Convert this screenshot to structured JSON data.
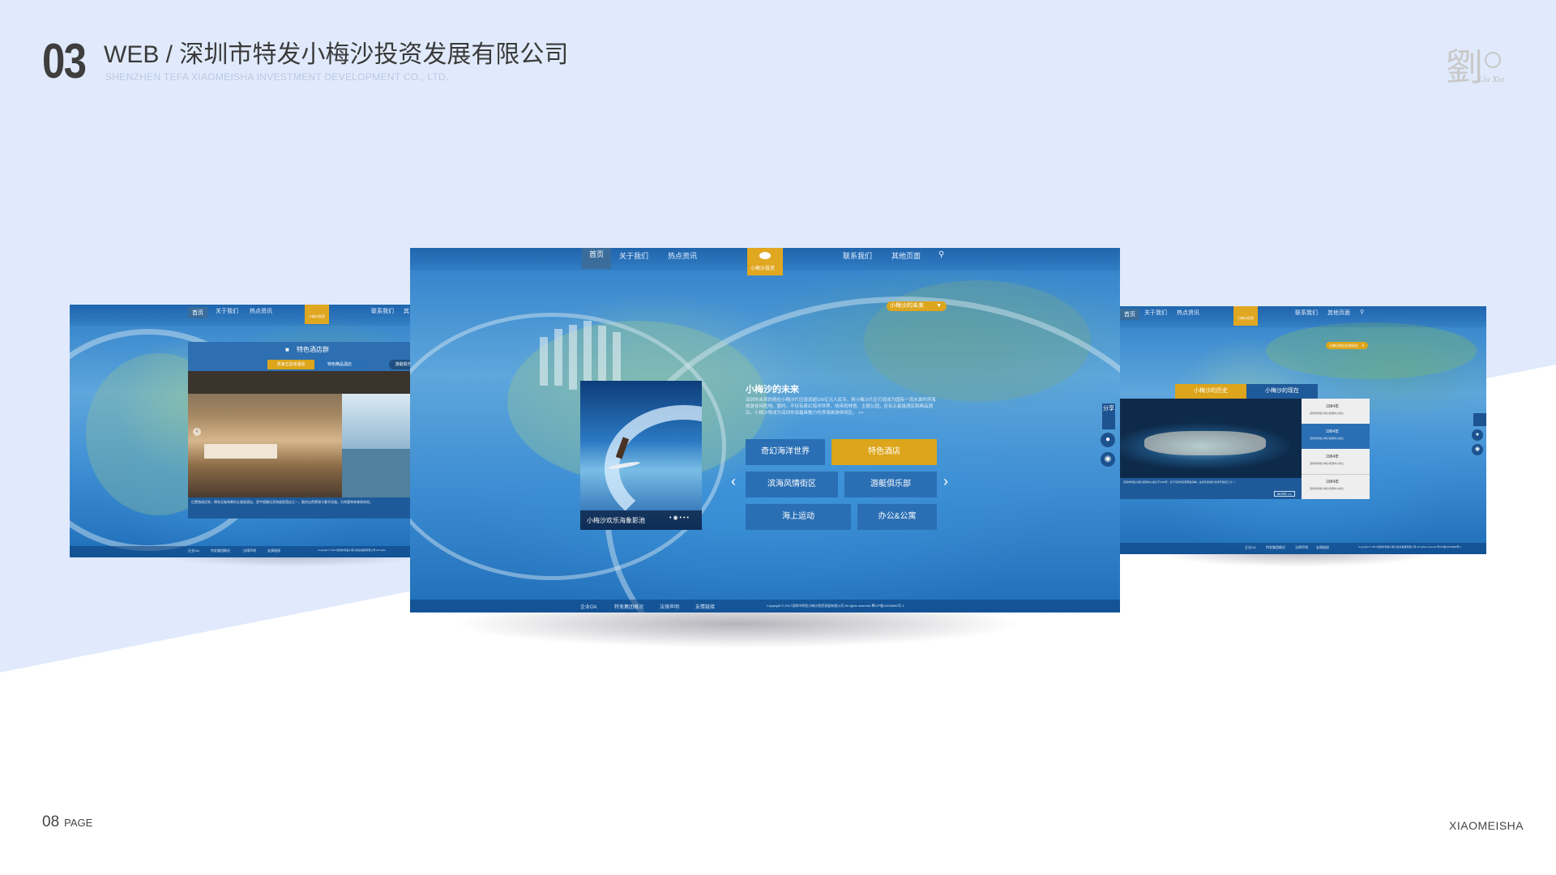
{
  "header": {
    "number": "03",
    "title": "WEB / 深圳市特发小梅沙投资发展有限公司",
    "subtitle": "SHENZHEN TEFA XIAOMEISHA INVESTMENT DEVELOPMENT CO., LTD."
  },
  "signature": {
    "glyph": "劉",
    "name": "Liu Xia"
  },
  "footer": {
    "page_number": "08",
    "page_label": "PAGE",
    "brand": "XIAOMEISHA"
  },
  "center_screen": {
    "nav": {
      "home": "首页",
      "about": "关于我们",
      "news": "热点资讯",
      "logo": "小梅沙投资",
      "contact": "联系我们",
      "other": "其他页面",
      "search_icon": "search-icon"
    },
    "dropdown": "小梅沙的未来",
    "feature_caption": "小梅沙欢乐海象影池",
    "section_title": "小梅沙的未来",
    "section_text": "深圳市未来的将在小梅沙片区投资超150亿元人民币，将小梅沙片区打造成为国际一流水准的滨海旅游休闲胜地。届时，不仅有奇幻海洋世界、热带雨林馆、主题公园，还有五星级酒店和精品酒店，小梅沙将成为深圳东部最具魅力的滨海旅游休闲区。 >>",
    "tiles": [
      "奇幻海洋世界",
      "特色酒店",
      "滨海风情街区",
      "游艇俱乐部",
      "海上运动",
      "办公&公寓"
    ],
    "share": "分享",
    "footer_links": [
      "企业OA",
      "特发集团概况",
      "法律声明",
      "友情链接"
    ],
    "copyright": "Copyright © 2017深圳市特发小梅沙投资发展有限公司 All rights reserved 粤ICP备12033882号-1"
  },
  "left_screen": {
    "nav": {
      "home": "首页",
      "about": "关于我们",
      "news": "热点资讯",
      "logo": "小梅沙投资",
      "contact": "联系我们",
      "other": "其"
    },
    "card_title": "特色酒店群",
    "tabs": [
      "滨海五星级酒店",
      "特色精品酒店",
      "游艇俱乐部"
    ],
    "card_text": "位置独具优势，拥有无敌海景的五星级酒店，是中国最佳滨海度假酒店之一，融合自然景观与奢华设施，为宾客带来尊贵体验。",
    "footer_links": [
      "企业OA",
      "特发集团概况",
      "法律声明",
      "友情链接"
    ],
    "copyright": "Copyright © 2017深圳市特发小梅沙投资发展有限公司 All rights"
  },
  "right_screen": {
    "nav": {
      "home": "首页",
      "about": "关于我们",
      "news": "热点资讯",
      "logo": "小梅沙投资",
      "contact": "联系我们",
      "other": "其他页面"
    },
    "dropdown": "小梅沙的历史和现在",
    "tabs": [
      "小梅沙的历史",
      "小梅沙的现在"
    ],
    "timeline": [
      {
        "year": "1984年",
        "text": "深圳市特发小梅沙旅游中心成立"
      },
      {
        "year": "1984年",
        "text": "深圳市特发小梅沙旅游中心成立"
      },
      {
        "year": "1984年",
        "text": "深圳市特发小梅沙旅游中心成立"
      },
      {
        "year": "1984年",
        "text": "深圳市特发小梅沙旅游中心成立"
      }
    ],
    "body_text": "深圳市特发小梅沙旅游中心成立于1984年，位于深圳市东部黄金海岸，是当年深圳的“改革开放窗口”之一。",
    "more": "MORE >>",
    "footer_links": [
      "企业OA",
      "特发集团概况",
      "法律声明",
      "友情链接"
    ],
    "copyright": "Copyright © 2017深圳市特发小梅沙投资发展有限公司 All rights reserved 粤ICP备12033882号-1"
  },
  "colors": {
    "accent_gold": "#dca51b",
    "accent_blue": "#2a6fb4",
    "page_bg": "#e0eafc"
  }
}
